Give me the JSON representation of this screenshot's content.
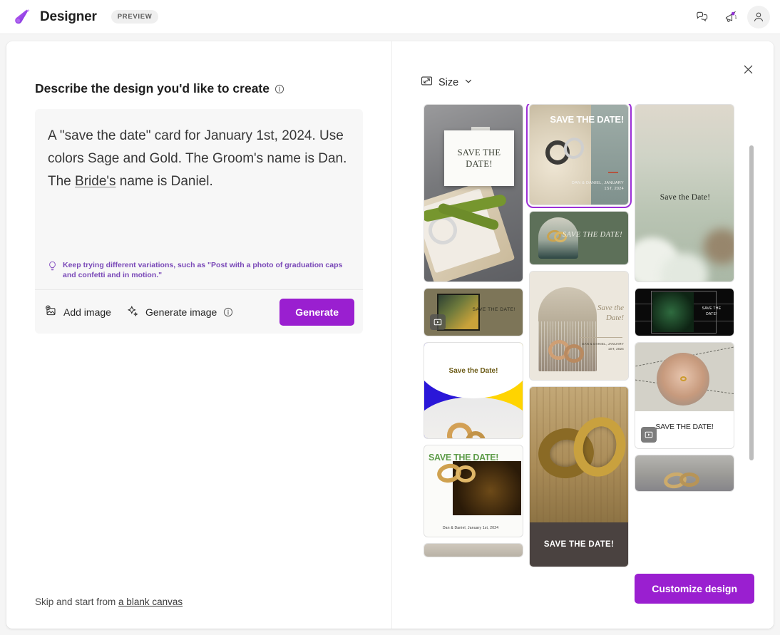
{
  "header": {
    "app_title": "Designer",
    "preview_badge": "PREVIEW",
    "icons": {
      "logo": "designer-logo-icon",
      "feedback": "feedback-icon",
      "announcements": "megaphone-icon",
      "account": "account-avatar-icon"
    }
  },
  "left_pane": {
    "heading": "Describe the design you'd like to create",
    "heading_info_icon": "info-icon",
    "prompt": {
      "value_part1": "A \"save the date\" card for January 1st, 2024. Use colors Sage and Gold. The Groom's name is Dan. The ",
      "value_spellcheck": "Bride's",
      "value_part2": " name is Daniel.",
      "full_value": "A \"save the date\" card for January 1st, 2024. Use colors Sage and Gold. The Groom's name is Dan. The Bride's name is Daniel.",
      "placeholder": "Describe the design you'd like to create"
    },
    "hint": {
      "icon": "lightbulb-icon",
      "text": "Keep trying different variations, such as \"Post with a photo of graduation caps and confetti and in motion.\""
    },
    "toolbar": {
      "add_image_label": "Add image",
      "add_image_icon": "add-image-icon",
      "generate_image_label": "Generate image",
      "generate_image_icon": "sparkle-icon",
      "generate_image_info_icon": "info-icon",
      "generate_label": "Generate",
      "generate_color": "#9a1fd0"
    },
    "footer": {
      "skip_text": "Skip and start from ",
      "blank_canvas_link": "a blank canvas"
    }
  },
  "right_pane": {
    "close_icon": "close-icon",
    "size_label": "Size",
    "size_icon": "resize-icon",
    "size_chevron_icon": "chevron-down-icon",
    "customize_label": "Customize design",
    "customize_color": "#9a1fd0",
    "selection_color": "#9b2fd6",
    "scrollbar": "vertical-scrollbar",
    "thumbnails": [
      {
        "id": "ring-box-green-ribbon",
        "title": "SAVE THE DATE!",
        "selected": false,
        "is_video": false
      },
      {
        "id": "olive-video-card",
        "title": "SAVE THE DATE!",
        "selected": false,
        "is_video": true,
        "video_icon": "play-badge-icon"
      },
      {
        "id": "blue-yellow-rings",
        "title": "Save the Date!",
        "selected": false,
        "is_video": false
      },
      {
        "id": "white-green-title-rings",
        "title": "SAVE THE DATE!",
        "caption": "Dan & Daniel, January 1st, 2024",
        "selected": false,
        "is_video": false
      },
      {
        "id": "lace-sage-rings",
        "title": "SAVE THE DATE!",
        "caption": "DAN & DANIEL, JANUARY 1ST, 2024",
        "selected": true,
        "is_video": false
      },
      {
        "id": "sage-green-arch",
        "title": "SAVE THE DATE!",
        "selected": false,
        "is_video": false
      },
      {
        "id": "beige-script-rings",
        "title": "Save the Date!",
        "caption": "DAN & DANIEL, JANUARY 1ST, 2024",
        "selected": false,
        "is_video": false
      },
      {
        "id": "gold-rings-brown-band",
        "title": "SAVE THE DATE!",
        "selected": false,
        "is_video": false
      },
      {
        "id": "blurred-white-flowers",
        "title": "Save the Date!",
        "selected": false,
        "is_video": false
      },
      {
        "id": "dark-green-ring-frame",
        "title": "SAVE THE DATE!",
        "selected": false,
        "is_video": false
      },
      {
        "id": "hand-holding-ring-video",
        "title": "SAVE THE DATE!",
        "selected": false,
        "is_video": true,
        "video_icon": "play-badge-icon"
      },
      {
        "id": "gold-rings-grey-partial",
        "title": "",
        "selected": false,
        "is_video": false
      }
    ]
  }
}
